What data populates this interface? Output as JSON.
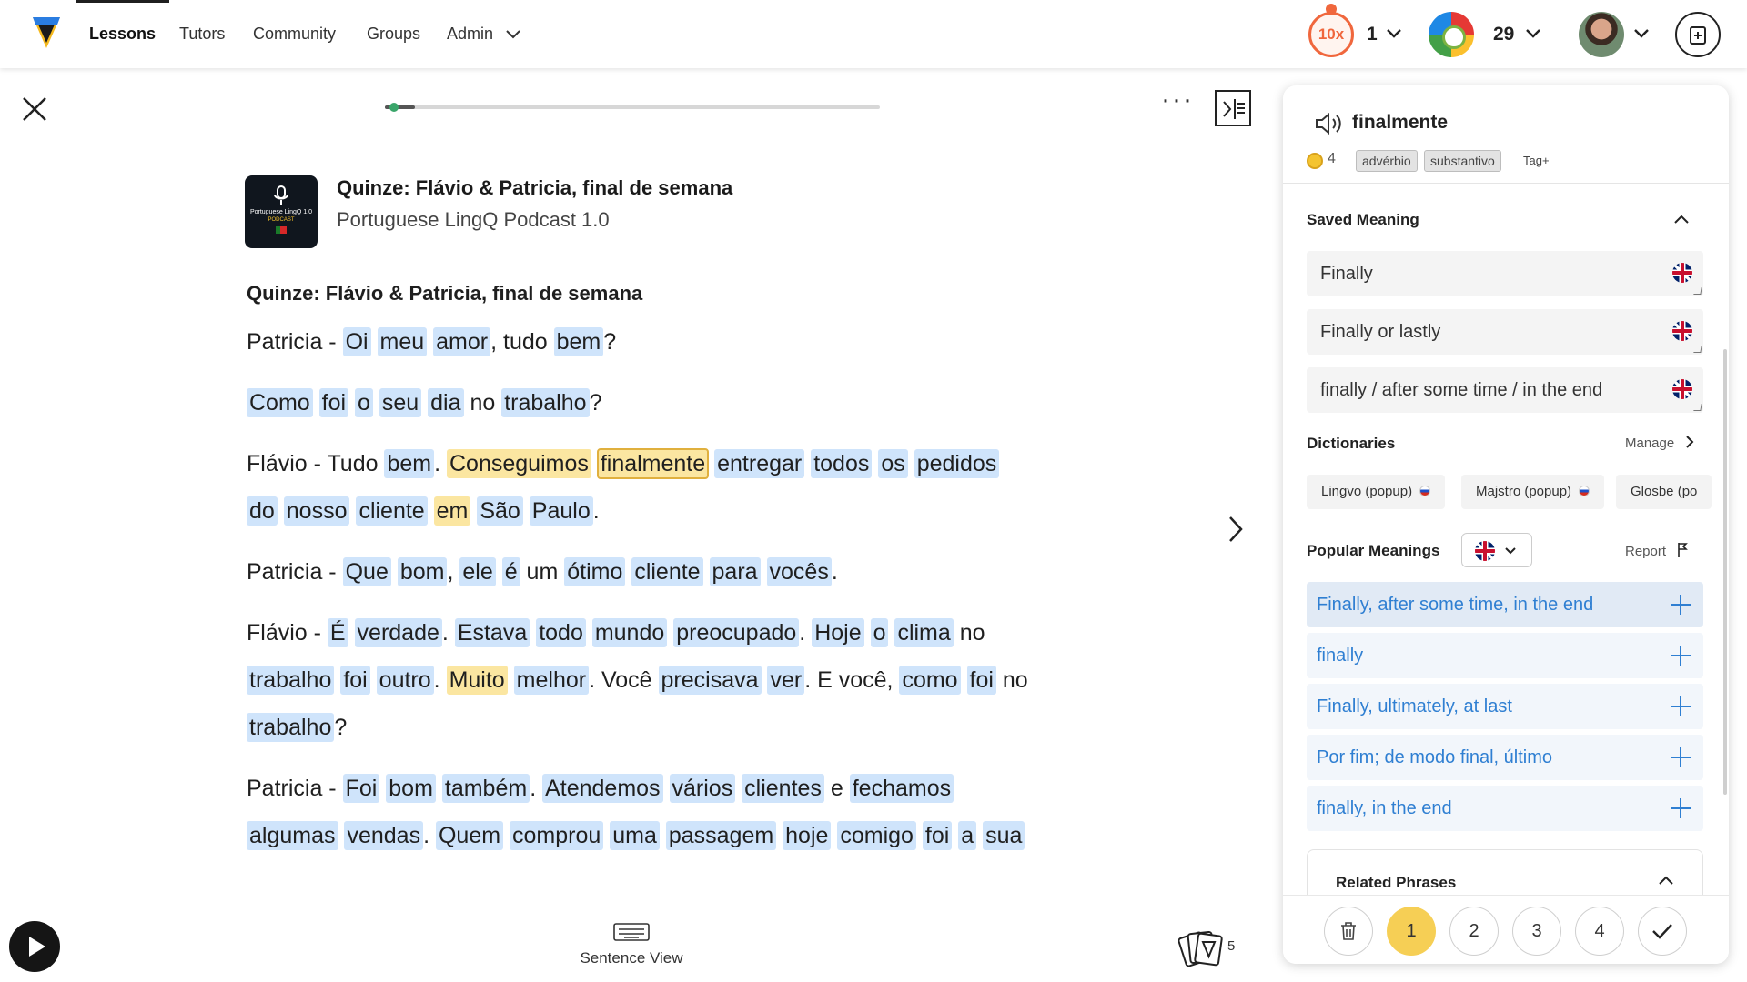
{
  "nav": {
    "items": [
      "Lessons",
      "Tutors",
      "Community",
      "Groups",
      "Admin"
    ],
    "streak_label": "10x",
    "streak_count": "1",
    "coins_count": "29"
  },
  "reader": {
    "progress_fraction": 0.06,
    "lesson_title": "Quinze: Flávio & Patricia, final de semana",
    "course_title": "Portuguese LingQ Podcast 1.0",
    "thumbnail_text": "Portuguese LingQ 1.0",
    "thumbnail_sub": "PODCAST",
    "text_heading": "Quinze: Flávio & Patricia, final de semana",
    "paragraphs": [
      [
        [
          "Patricia - ",
          "k"
        ],
        [
          "Oi",
          "b"
        ],
        [
          " ",
          "k"
        ],
        [
          "meu",
          "b"
        ],
        [
          " ",
          "k"
        ],
        [
          "amor",
          "b"
        ],
        [
          ", tudo ",
          "k"
        ],
        [
          "bem",
          "b"
        ],
        [
          "?",
          "k"
        ]
      ],
      [
        [
          "Como",
          "b"
        ],
        [
          " ",
          "k"
        ],
        [
          "foi",
          "b"
        ],
        [
          " ",
          "k"
        ],
        [
          "o",
          "b"
        ],
        [
          " ",
          "k"
        ],
        [
          "seu",
          "b"
        ],
        [
          " ",
          "k"
        ],
        [
          "dia",
          "b"
        ],
        [
          " no ",
          "k"
        ],
        [
          "trabalho",
          "b"
        ],
        [
          "?",
          "k"
        ]
      ],
      [
        [
          "Flávio - Tudo ",
          "k"
        ],
        [
          "bem",
          "b"
        ],
        [
          ". ",
          "k"
        ],
        [
          "Conseguimos",
          "y"
        ],
        [
          " ",
          "k"
        ],
        [
          "finalmente",
          "s"
        ],
        [
          " ",
          "k"
        ],
        [
          "entregar",
          "b"
        ],
        [
          " ",
          "k"
        ],
        [
          "todos",
          "b"
        ],
        [
          " ",
          "k"
        ],
        [
          "os",
          "b"
        ],
        [
          " ",
          "k"
        ],
        [
          "pedidos",
          "b"
        ],
        [
          " ",
          "k"
        ],
        [
          "do",
          "b"
        ],
        [
          " ",
          "k"
        ],
        [
          "nosso",
          "b"
        ],
        [
          " ",
          "k"
        ],
        [
          "cliente",
          "b"
        ],
        [
          " ",
          "k"
        ],
        [
          "em",
          "y"
        ],
        [
          " ",
          "k"
        ],
        [
          "São",
          "b"
        ],
        [
          " ",
          "k"
        ],
        [
          "Paulo",
          "b"
        ],
        [
          ".",
          "k"
        ]
      ],
      [
        [
          "Patricia - ",
          "k"
        ],
        [
          "Que",
          "b"
        ],
        [
          " ",
          "k"
        ],
        [
          "bom",
          "b"
        ],
        [
          ", ",
          "k"
        ],
        [
          "ele",
          "b"
        ],
        [
          " ",
          "k"
        ],
        [
          "é",
          "b"
        ],
        [
          " um ",
          "k"
        ],
        [
          "ótimo",
          "b"
        ],
        [
          " ",
          "k"
        ],
        [
          "cliente",
          "b"
        ],
        [
          " ",
          "k"
        ],
        [
          "para",
          "b"
        ],
        [
          " ",
          "k"
        ],
        [
          "vocês",
          "b"
        ],
        [
          ".",
          "k"
        ]
      ],
      [
        [
          "Flávio - ",
          "k"
        ],
        [
          "É",
          "b"
        ],
        [
          " ",
          "k"
        ],
        [
          "verdade",
          "b"
        ],
        [
          ". ",
          "k"
        ],
        [
          "Estava",
          "b"
        ],
        [
          " ",
          "k"
        ],
        [
          "todo",
          "b"
        ],
        [
          " ",
          "k"
        ],
        [
          "mundo",
          "b"
        ],
        [
          " ",
          "k"
        ],
        [
          "preocupado",
          "b"
        ],
        [
          ". ",
          "k"
        ],
        [
          "Hoje",
          "b"
        ],
        [
          " ",
          "k"
        ],
        [
          "o",
          "b"
        ],
        [
          " ",
          "k"
        ],
        [
          "clima",
          "b"
        ],
        [
          " no ",
          "k"
        ],
        [
          "trabalho",
          "b"
        ],
        [
          " ",
          "k"
        ],
        [
          "foi",
          "b"
        ],
        [
          " ",
          "k"
        ],
        [
          "outro",
          "b"
        ],
        [
          ". ",
          "k"
        ],
        [
          "Muito",
          "y"
        ],
        [
          " ",
          "k"
        ],
        [
          "melhor",
          "b"
        ],
        [
          ". Você ",
          "k"
        ],
        [
          "precisava",
          "b"
        ],
        [
          " ",
          "k"
        ],
        [
          "ver",
          "b"
        ],
        [
          ". E você, ",
          "k"
        ],
        [
          "como",
          "b"
        ],
        [
          " ",
          "k"
        ],
        [
          "foi",
          "b"
        ],
        [
          " no ",
          "k"
        ],
        [
          "trabalho",
          "b"
        ],
        [
          "?",
          "k"
        ]
      ],
      [
        [
          "Patricia - ",
          "k"
        ],
        [
          "Foi",
          "b"
        ],
        [
          " ",
          "k"
        ],
        [
          "bom",
          "b"
        ],
        [
          " ",
          "k"
        ],
        [
          "também",
          "b"
        ],
        [
          ". ",
          "k"
        ],
        [
          "Atendemos",
          "b"
        ],
        [
          " ",
          "k"
        ],
        [
          "vários",
          "b"
        ],
        [
          " ",
          "k"
        ],
        [
          "clientes",
          "b"
        ],
        [
          " e ",
          "k"
        ],
        [
          "fechamos",
          "b"
        ],
        [
          " ",
          "k"
        ],
        [
          "algumas",
          "b"
        ],
        [
          " ",
          "k"
        ],
        [
          "vendas",
          "b"
        ],
        [
          ". ",
          "k"
        ],
        [
          "Quem",
          "b"
        ],
        [
          " ",
          "k"
        ],
        [
          "comprou",
          "b"
        ],
        [
          " ",
          "k"
        ],
        [
          "uma",
          "b"
        ],
        [
          " ",
          "k"
        ],
        [
          "passagem",
          "b"
        ],
        [
          " ",
          "k"
        ],
        [
          "hoje",
          "b"
        ],
        [
          " ",
          "k"
        ],
        [
          "comigo",
          "b"
        ],
        [
          " ",
          "k"
        ],
        [
          "foi",
          "b"
        ],
        [
          " ",
          "k"
        ],
        [
          "a",
          "b"
        ],
        [
          " ",
          "k"
        ],
        [
          "sua",
          "b"
        ]
      ]
    ],
    "sentence_view_label": "Sentence View",
    "lingqs_count": "5"
  },
  "panel": {
    "term": "finalmente",
    "coin_count": "4",
    "tags": [
      "advérbio",
      "substantivo"
    ],
    "tag_add_label": "Tag+",
    "saved_meaning_title": "Saved Meaning",
    "saved_meanings": [
      "Finally",
      "Finally or lastly",
      "finally / after some time / in the end"
    ],
    "dictionaries_title": "Dictionaries",
    "manage_label": "Manage",
    "dictionaries": [
      "Lingvo (popup)",
      "Majstro (popup)",
      "Glosbe (po"
    ],
    "popular_meanings_title": "Popular Meanings",
    "report_label": "Report",
    "popular_meanings": [
      "Finally, after some time, in the end",
      "finally",
      "Finally, ultimately, at last",
      "Por fim; de modo final, último",
      "finally, in the end"
    ],
    "related_phrases_title": "Related Phrases",
    "levels": [
      "1",
      "2",
      "3",
      "4"
    ],
    "active_level": "1"
  },
  "colors": {
    "blue_highlight": "#cfe4fb",
    "yellow_highlight": "#fbe6a1",
    "link_blue": "#2f7fd2",
    "active_level": "#f6cf55"
  }
}
